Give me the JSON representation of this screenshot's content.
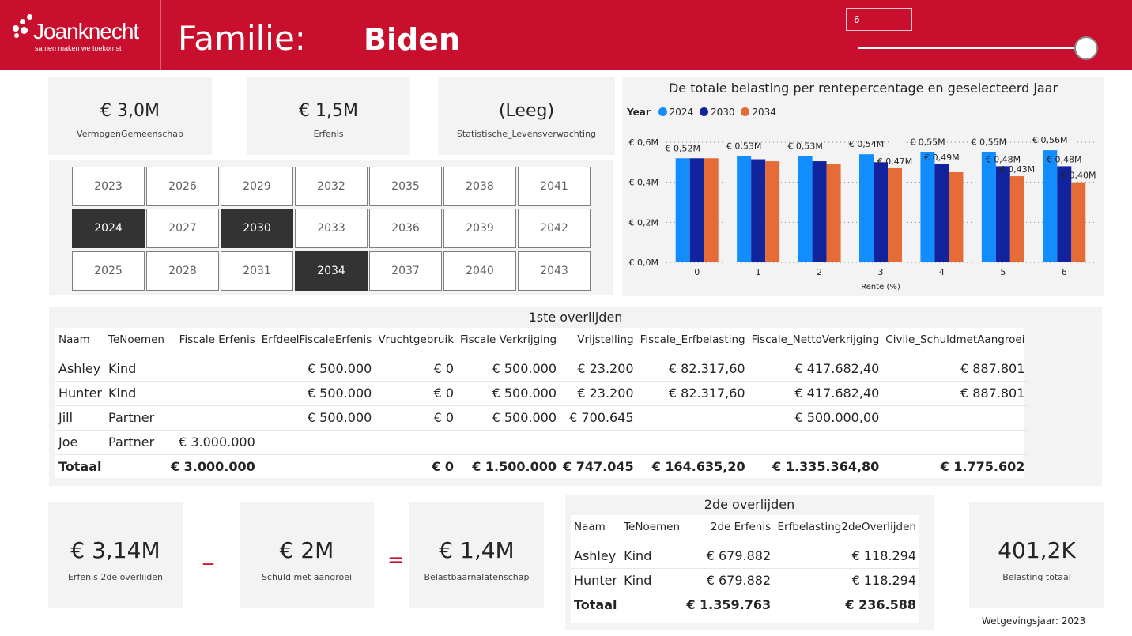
{
  "header": {
    "logo_name": "Joanknecht",
    "logo_tagline": "samen maken we toekomst",
    "family_label": "Familie:",
    "family_name": "Biden",
    "slider_value": "6",
    "slider_fraction": 1.0
  },
  "kpis_top": [
    {
      "value": "€ 3,0M",
      "label": "VermogenGemeenschap"
    },
    {
      "value": "€ 1,5M",
      "label": "Erfenis"
    },
    {
      "value": "(Leeg)",
      "label": "Statistische_Levensverwachting"
    }
  ],
  "years": {
    "rows": [
      [
        "2023",
        "2026",
        "2029",
        "2032",
        "2035",
        "2038",
        "2041"
      ],
      [
        "2024",
        "2027",
        "2030",
        "2033",
        "2036",
        "2039",
        "2042"
      ],
      [
        "2025",
        "2028",
        "2031",
        "2034",
        "2037",
        "2040",
        "2043"
      ]
    ],
    "selected": [
      "2024",
      "2030",
      "2034"
    ]
  },
  "chart_data": {
    "type": "bar",
    "title": "De totale belasting per rentepercentage en geselecteerd jaar",
    "xlabel": "Rente (%)",
    "ylabel": "",
    "legend_title": "Year",
    "legend_position": "top-left",
    "categories": [
      "0",
      "1",
      "2",
      "3",
      "4",
      "5",
      "6"
    ],
    "y_ticks": [
      "€ 0,0M",
      "€ 0,2M",
      "€ 0,4M",
      "€ 0,6M"
    ],
    "ylim": [
      0,
      0.6
    ],
    "grid": true,
    "series": [
      {
        "name": "2024",
        "color": "#118dff",
        "values": [
          0.52,
          0.53,
          0.53,
          0.54,
          0.55,
          0.55,
          0.56
        ],
        "labels": [
          "€ 0,52M",
          "€ 0,53M",
          "€ 0,53M",
          "€ 0,54M",
          "€ 0,55M",
          "€ 0,55M",
          "€ 0,56M"
        ]
      },
      {
        "name": "2030",
        "color": "#12239e",
        "values": [
          0.52,
          0.515,
          0.505,
          0.5,
          0.49,
          0.48,
          0.48
        ],
        "labels": [
          "",
          "",
          "",
          "",
          "€ 0,49M",
          "€ 0,48M",
          "€ 0,48M"
        ]
      },
      {
        "name": "2034",
        "color": "#e66c37",
        "values": [
          0.52,
          0.505,
          0.49,
          0.47,
          0.45,
          0.43,
          0.4
        ],
        "labels": [
          "",
          "",
          "",
          "€ 0,47M",
          "",
          "€ 0,43M",
          "€ 0,40M"
        ]
      }
    ]
  },
  "first_death": {
    "title": "1ste overlijden",
    "columns": [
      "Naam",
      "TeNoemen",
      "Fiscale Erfenis",
      "ErfdeelFiscaleErfenis",
      "Vruchtgebruik",
      "Fiscale Verkrijging",
      "Vrijstelling",
      "Fiscale_Erfbelasting",
      "Fiscale_NettoVerkrijging",
      "Civile_SchuldmetAangroei"
    ],
    "rows": [
      [
        "Ashley",
        "Kind",
        "",
        "€ 500.000",
        "€ 0",
        "€ 500.000",
        "€ 23.200",
        "€ 82.317,60",
        "€ 417.682,40",
        "€ 887.801"
      ],
      [
        "Hunter",
        "Kind",
        "",
        "€ 500.000",
        "€ 0",
        "€ 500.000",
        "€ 23.200",
        "€ 82.317,60",
        "€ 417.682,40",
        "€ 887.801"
      ],
      [
        "Jill",
        "Partner",
        "",
        "€ 500.000",
        "€ 0",
        "€ 500.000",
        "€ 700.645",
        "",
        "€ 500.000,00",
        ""
      ],
      [
        "Joe",
        "Partner",
        "€ 3.000.000",
        "",
        "",
        "",
        "",
        "",
        "",
        ""
      ]
    ],
    "total": [
      "Totaal",
      "",
      "€ 3.000.000",
      "",
      "€ 0",
      "€ 1.500.000",
      "€ 747.045",
      "€ 164.635,20",
      "€ 1.335.364,80",
      "€ 1.775.602"
    ]
  },
  "kpis_bottom": [
    {
      "value": "€ 3,14M",
      "label": "Erfenis 2de overlijden"
    },
    {
      "value": "€ 2M",
      "label": "Schuld met aangroei"
    },
    {
      "value": "€ 1,4M",
      "label": "Belastbaarnalatenschap"
    }
  ],
  "operators": {
    "minus": "_",
    "equals": "="
  },
  "second_death": {
    "title": "2de overlijden",
    "columns": [
      "Naam",
      "TeNoemen",
      "2de Erfenis",
      "Erfbelasting2deOverlijden"
    ],
    "rows": [
      [
        "Ashley",
        "Kind",
        "€ 679.882",
        "€ 118.294"
      ],
      [
        "Hunter",
        "Kind",
        "€ 679.882",
        "€ 118.294"
      ]
    ],
    "total": [
      "Totaal",
      "",
      "€ 1.359.763",
      "€ 236.588"
    ]
  },
  "tax_total": {
    "value": "401,2K",
    "label": "Belasting totaal"
  },
  "wetgevingsjaar": "Wetgevingsjaar: 2023"
}
